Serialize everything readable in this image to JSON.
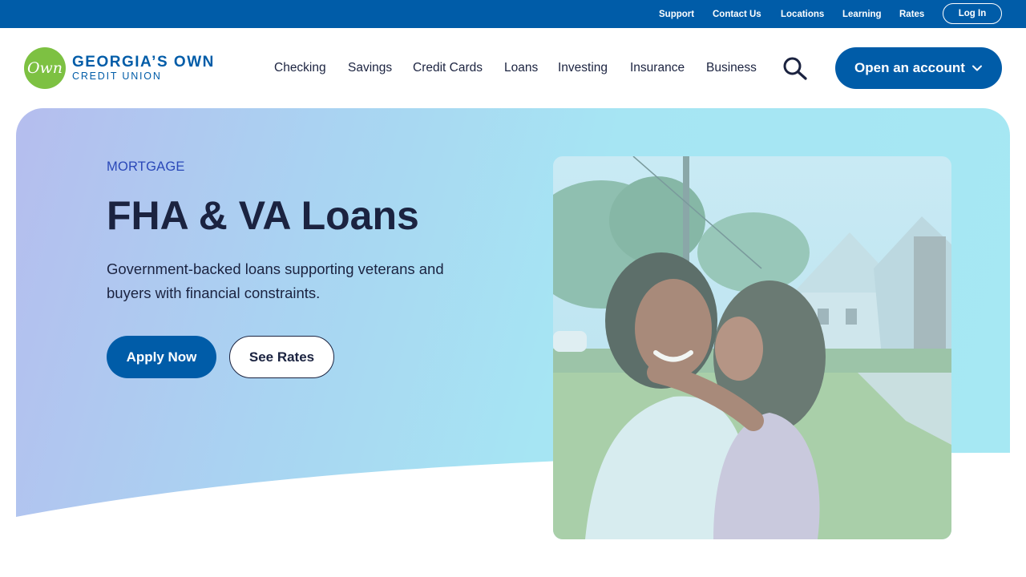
{
  "topbar": {
    "links": [
      "Support",
      "Contact Us",
      "Locations",
      "Learning",
      "Rates"
    ],
    "login_label": "Log In"
  },
  "logo": {
    "mark": "Own",
    "line1": "GEORGIA’S OWN",
    "line2": "CREDIT UNION"
  },
  "nav": {
    "items": [
      "Checking",
      "Savings",
      "Credit Cards",
      "Loans",
      "Investing",
      "Insurance",
      "Business"
    ],
    "search_icon": "search-icon",
    "open_account_label": "Open an account"
  },
  "hero": {
    "eyebrow": "MORTGAGE",
    "title": "FHA & VA Loans",
    "description": "Government-backed loans supporting veterans and buyers with financial constraints.",
    "apply_label": "Apply Now",
    "rates_label": "See Rates"
  },
  "colors": {
    "brand_blue": "#005ca8",
    "brand_green": "#7dc142",
    "text_dark": "#1b2340",
    "eyebrow_blue": "#2a48b8"
  }
}
